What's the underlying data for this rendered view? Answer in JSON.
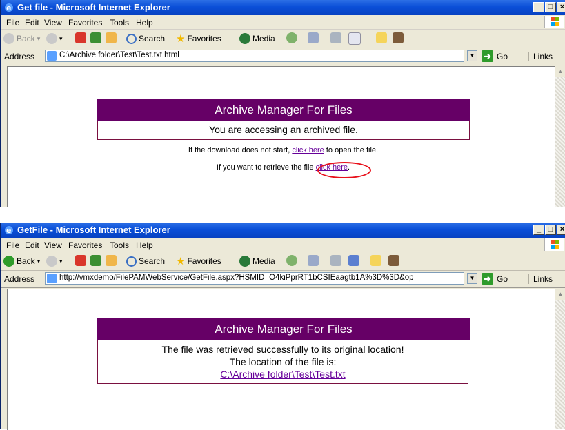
{
  "window1": {
    "title": "Get file - Microsoft Internet Explorer",
    "menu": [
      "File",
      "Edit",
      "View",
      "Favorites",
      "Tools",
      "Help"
    ],
    "toolbar": {
      "back": "Back",
      "search": "Search",
      "favorites": "Favorites",
      "media": "Media"
    },
    "address_label": "Address",
    "address_value": "C:\\Archive folder\\Test\\Test.txt.html",
    "go_label": "Go",
    "links_label": "Links",
    "page": {
      "header": "Archive Manager For Files",
      "subheader": "You are accessing an archived file.",
      "line1_prefix": "If the download does not start, ",
      "line1_link": "click here",
      "line1_suffix": " to open the file.",
      "line2_prefix": "If you want to retrieve the file ",
      "line2_link": "click here",
      "line2_suffix": "."
    }
  },
  "window2": {
    "title": "GetFile - Microsoft Internet Explorer",
    "menu": [
      "File",
      "Edit",
      "View",
      "Favorites",
      "Tools",
      "Help"
    ],
    "toolbar": {
      "back": "Back",
      "search": "Search",
      "favorites": "Favorites",
      "media": "Media"
    },
    "address_label": "Address",
    "address_value": "http://vmxdemo/FilePAMWebService/GetFile.aspx?HSMID=O4kiPprRT1bCSIEaagtb1A%3D%3D&op=",
    "go_label": "Go",
    "links_label": "Links",
    "page": {
      "header": "Archive Manager For Files",
      "message1": "The file was retrieved successfully to its original location!",
      "message2": "The location of the file is:",
      "file_link": "C:\\Archive folder\\Test\\Test.txt"
    }
  },
  "colors": {
    "header_bg": "#660066",
    "link": "#660099",
    "highlight_oval": "#e8101a",
    "titlebar": "#0a4fd8"
  }
}
